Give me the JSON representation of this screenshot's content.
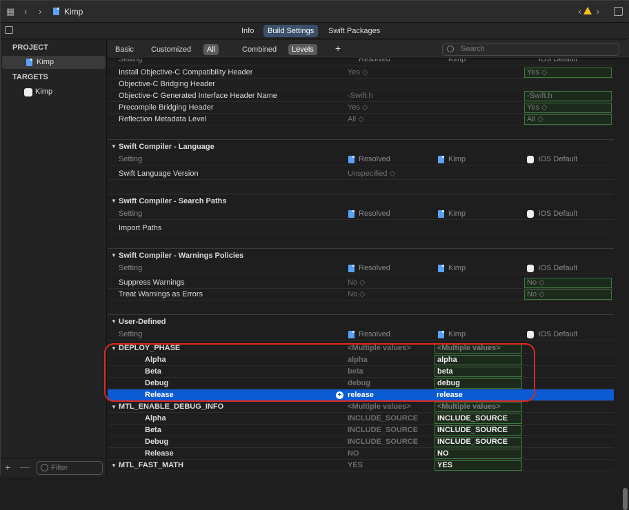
{
  "window": {
    "title": "Kimp"
  },
  "top_tabs": [
    {
      "label": "Info"
    },
    {
      "label": "Build Settings"
    },
    {
      "label": "Swift Packages"
    }
  ],
  "sidebar": {
    "project_header": "PROJECT",
    "project_item": "Kimp",
    "targets_header": "TARGETS",
    "target_item": "Kimp",
    "filter_placeholder": "Filter"
  },
  "filter_bar": {
    "basic": "Basic",
    "customized": "Customized",
    "all": "All",
    "combined": "Combined",
    "levels": "Levels",
    "add": "+",
    "search_placeholder": "Search"
  },
  "columns": {
    "setting": "Setting",
    "resolved": "Resolved",
    "kimp": "Kimp",
    "ios_default": "iOS Default"
  },
  "objc_rows": [
    {
      "name": "Install Objective-C Compatibility Header",
      "resolved": "Yes ◇",
      "default": "Yes ◇"
    },
    {
      "name": "Objective-C Bridging Header",
      "resolved": "",
      "default": ""
    },
    {
      "name": "Objective-C Generated Interface Header Name",
      "resolved": "-Swift.h",
      "default": "-Swift.h"
    },
    {
      "name": "Precompile Bridging Header",
      "resolved": "Yes ◇",
      "default": "Yes ◇"
    },
    {
      "name": "Reflection Metadata Level",
      "resolved": "All ◇",
      "default": "All ◇"
    }
  ],
  "sections": {
    "lang": "Swift Compiler - Language",
    "search": "Swift Compiler - Search Paths",
    "warn": "Swift Compiler - Warnings Policies",
    "user": "User-Defined"
  },
  "lang_rows": [
    {
      "name": "Swift Language Version",
      "resolved": "Unspecified ◇"
    }
  ],
  "search_rows": [
    {
      "name": "Import Paths"
    }
  ],
  "warn_rows": [
    {
      "name": "Suppress Warnings",
      "resolved": "No ◇",
      "default": "No ◇"
    },
    {
      "name": "Treat Warnings as Errors",
      "resolved": "No ◇",
      "default": "No ◇"
    }
  ],
  "user_rows": [
    {
      "name": "DEPLOY_PHASE",
      "resolved": "<Multiple values>",
      "kimp": "<Multiple values>",
      "level": 0
    },
    {
      "name": "Alpha",
      "resolved": "alpha",
      "kimp": "alpha",
      "level": 1
    },
    {
      "name": "Beta",
      "resolved": "beta",
      "kimp": "beta",
      "level": 1
    },
    {
      "name": "Debug",
      "resolved": "debug",
      "kimp": "debug",
      "level": 1
    },
    {
      "name": "Release",
      "resolved": "release",
      "kimp": "release",
      "level": 1,
      "selected": true
    },
    {
      "name": "MTL_ENABLE_DEBUG_INFO",
      "resolved": "<Multiple values>",
      "kimp": "<Multiple values>",
      "level": 0
    },
    {
      "name": "Alpha",
      "resolved": "INCLUDE_SOURCE",
      "kimp": "INCLUDE_SOURCE",
      "level": 1
    },
    {
      "name": "Beta",
      "resolved": "INCLUDE_SOURCE",
      "kimp": "INCLUDE_SOURCE",
      "level": 1
    },
    {
      "name": "Debug",
      "resolved": "INCLUDE_SOURCE",
      "kimp": "INCLUDE_SOURCE",
      "level": 1
    },
    {
      "name": "Release",
      "resolved": "NO",
      "kimp": "NO",
      "level": 1
    },
    {
      "name": "MTL_FAST_MATH",
      "resolved": "YES",
      "kimp": "YES",
      "level": 0
    }
  ],
  "colors": {
    "selection": "#0b5bd3",
    "highlight_ring": "#e0291a",
    "override_border": "#3d7a3d"
  }
}
